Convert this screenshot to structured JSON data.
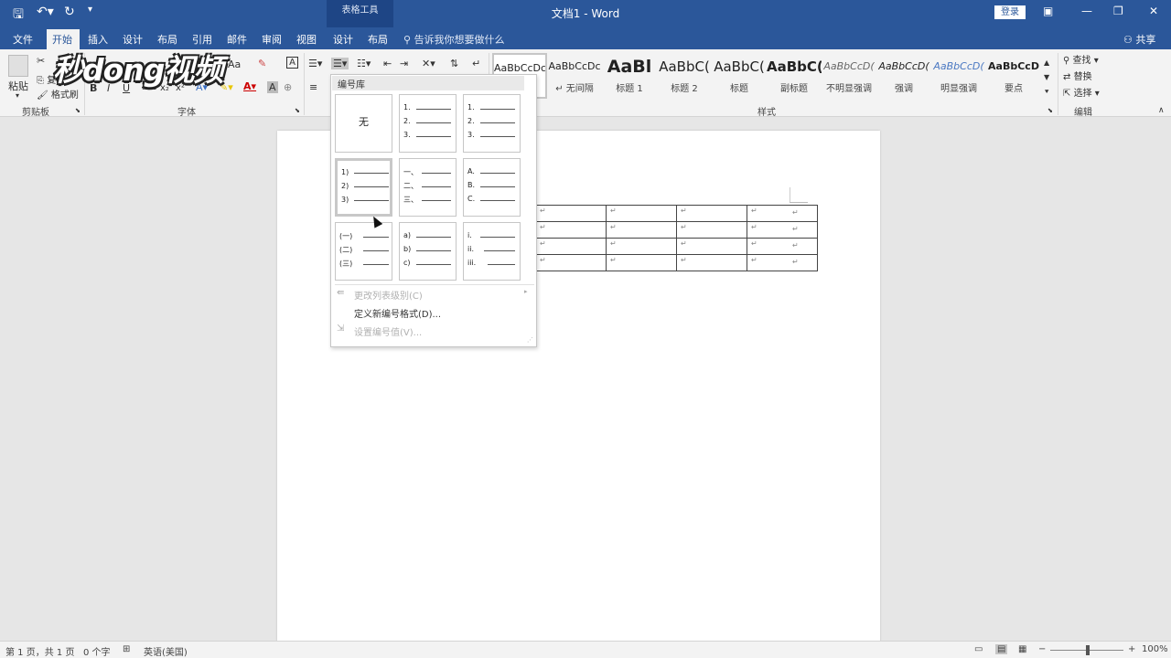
{
  "window": {
    "title": "文档1  -  Word",
    "context_tool": "表格工具",
    "login": "登录",
    "tell_me": "告诉我你想要做什么",
    "share": "共享"
  },
  "tabs": [
    "文件",
    "开始",
    "插入",
    "设计",
    "布局",
    "引用",
    "邮件",
    "审阅",
    "视图"
  ],
  "context_tabs": [
    "设计",
    "布局"
  ],
  "ribbon": {
    "clipboard": {
      "paste": "粘贴",
      "copy": "复制",
      "format_painter": "格式刷",
      "label": "剪贴板"
    },
    "font": {
      "label": "字体",
      "font_size_controls": "Aa",
      "bold": "B",
      "italic": "I",
      "underline": "U",
      "strike": "abc",
      "sub": "x₂",
      "sup": "x²"
    },
    "styles": {
      "label": "样式",
      "items": [
        {
          "preview": "AaBbCcDc",
          "name": ""
        },
        {
          "preview": "AaBbCcDc",
          "name": "↵ 无间隔"
        },
        {
          "preview": "AaBl",
          "name": "标题 1"
        },
        {
          "preview": "AaBbC(",
          "name": "标题 2"
        },
        {
          "preview": "AaBbC(",
          "name": "标题"
        },
        {
          "preview": "AaBbC(",
          "name": "副标题"
        },
        {
          "preview": "AaBbCcD(",
          "name": "不明显强调"
        },
        {
          "preview": "AaBbCcD(",
          "name": "强调"
        },
        {
          "preview": "AaBbCcD(",
          "name": "明显强调"
        },
        {
          "preview": "AaBbCcD",
          "name": "要点"
        }
      ]
    },
    "editing": {
      "label": "编辑",
      "find": "查找",
      "replace": "替换",
      "select": "选择"
    }
  },
  "watermark": "秒dong视频",
  "numbering_dropdown": {
    "header": "编号库",
    "tiles": [
      {
        "none": "无"
      },
      {
        "lines": [
          "1.",
          "2.",
          "3."
        ]
      },
      {
        "lines": [
          "1.",
          "2.",
          "3."
        ]
      },
      {
        "lines": [
          "1)",
          "2)",
          "3)"
        ]
      },
      {
        "lines": [
          "一、",
          "二、",
          "三、"
        ]
      },
      {
        "lines": [
          "A.",
          "B.",
          "C."
        ]
      },
      {
        "lines": [
          "(一)",
          "(二)",
          "(三)"
        ]
      },
      {
        "lines": [
          "a)",
          "b)",
          "c)"
        ]
      },
      {
        "lines": [
          "i.",
          "ii.",
          "iii."
        ]
      }
    ],
    "menu": [
      {
        "label": "更改列表级别(C)",
        "disabled": true
      },
      {
        "label": "定义新编号格式(D)...",
        "disabled": false
      },
      {
        "label": "设置编号值(V)...",
        "disabled": true
      }
    ]
  },
  "table": {
    "rows": 4,
    "cols": 4,
    "cell_mark": "↵"
  },
  "status": {
    "page": "第 1 页，共 1 页",
    "words": "0 个字",
    "language": "英语(美国)",
    "zoom": "100%"
  }
}
